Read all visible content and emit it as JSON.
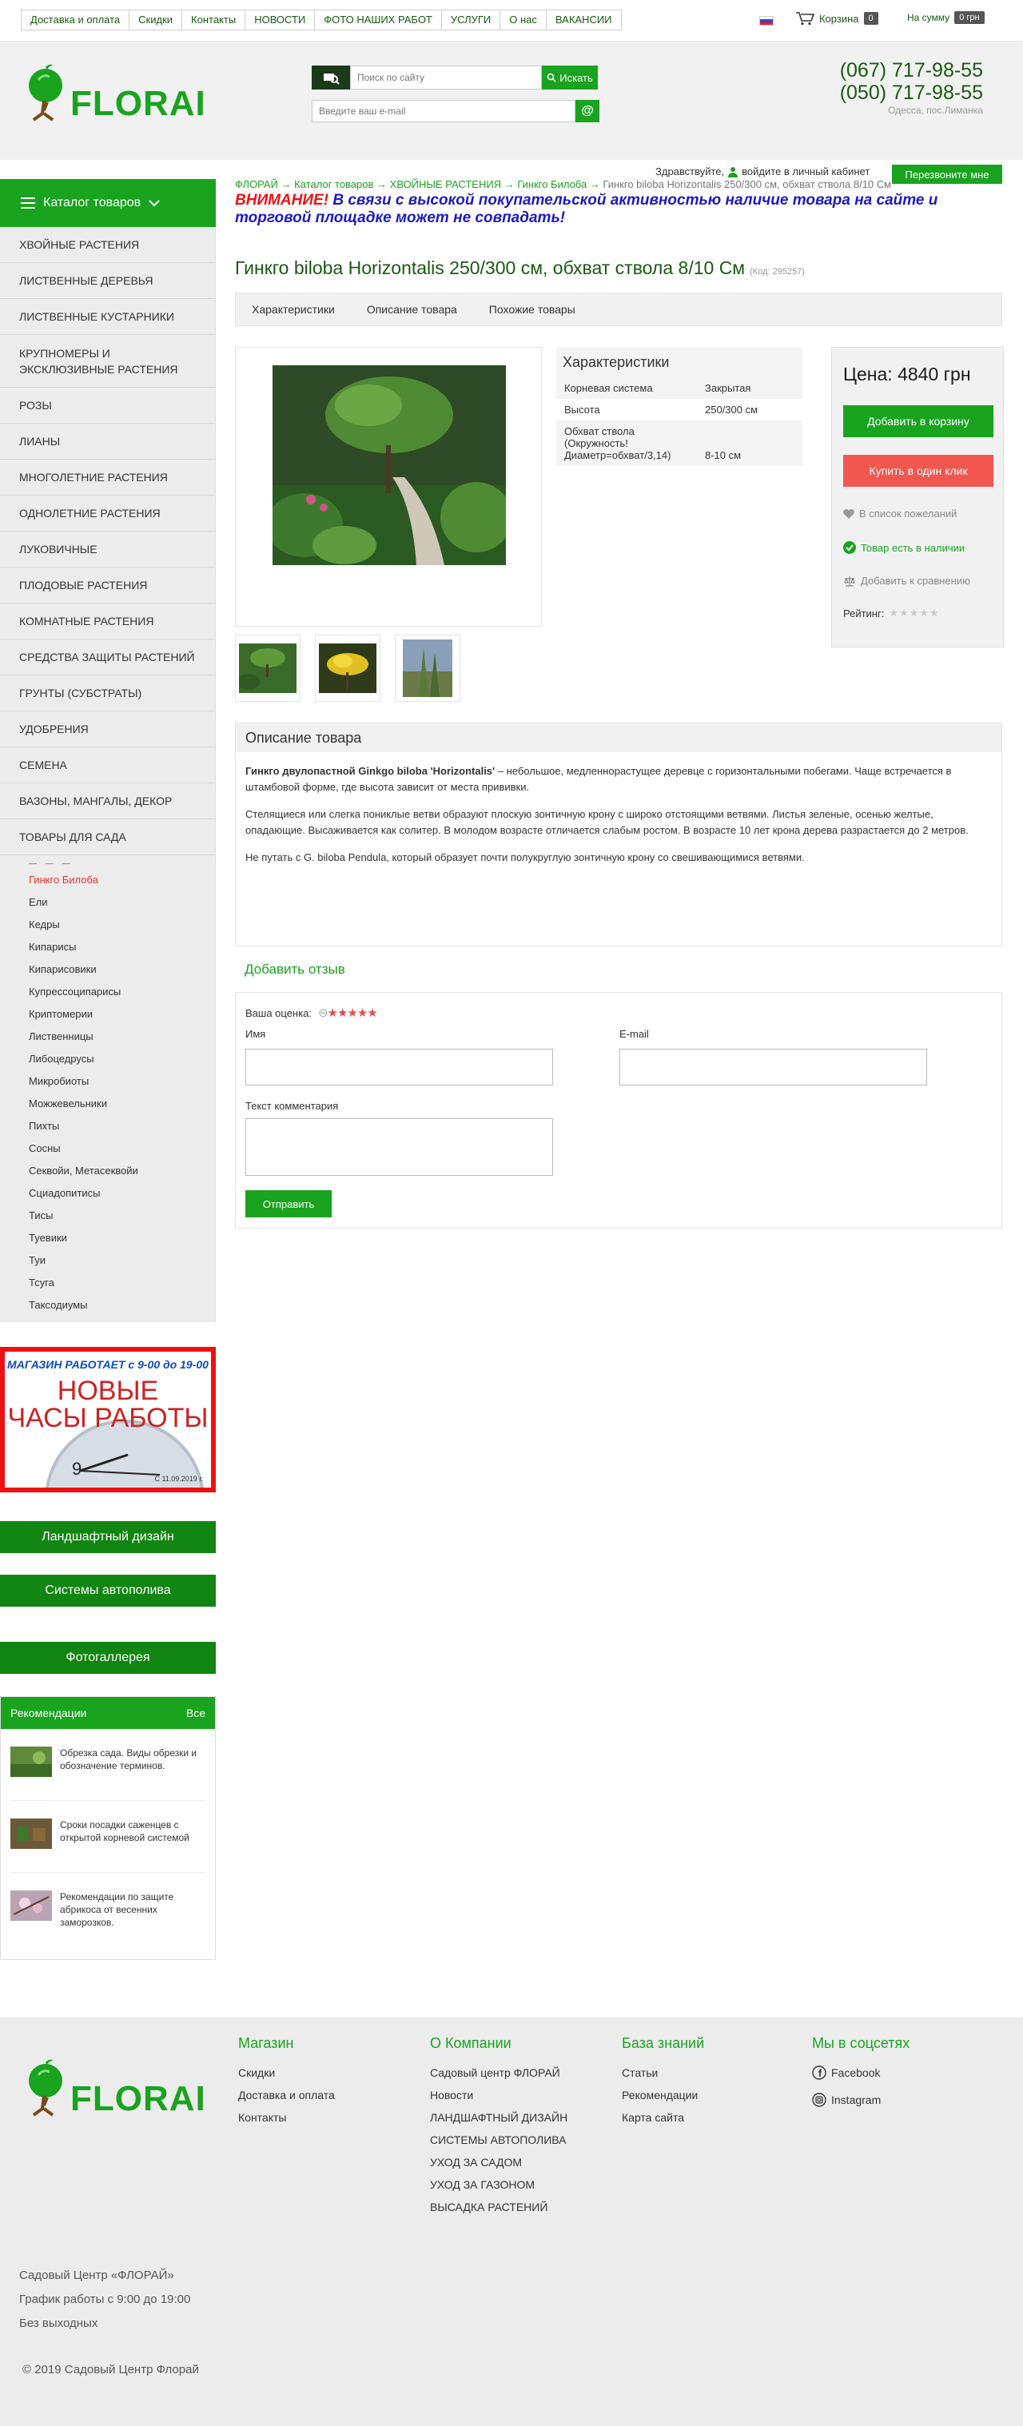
{
  "topnav": [
    "Доставка и оплата",
    "Скидки",
    "Контакты",
    "НОВОСТИ",
    "ФОТО НАШИХ РАБОТ",
    "УСЛУГИ",
    "О нас",
    "ВАКАНСИИ"
  ],
  "cart": {
    "label": "Корзина",
    "count": "0",
    "sum_label": "На сумму",
    "sum": "0 грн"
  },
  "logo": "FLORAI",
  "search": {
    "placeholder": "Поиск по сайту",
    "button": "Искать"
  },
  "email": {
    "placeholder": "Введите ваш e-mail",
    "button": "@"
  },
  "phones": [
    "(067) 717-98-55",
    "(050) 717-98-55"
  ],
  "city": "Одесса, пос.Лиманка",
  "greeting": "Здравствуйте,",
  "login_link": "войдите в личный кабинет",
  "callback": "Перезвоните мне",
  "catalog_title": "Каталог товаров",
  "categories": [
    "Хвойные растения",
    "Лиственные деревья",
    "Лиственные кустарники",
    "Крупномеры и эксклюзивные растения",
    "Розы",
    "Лианы",
    "Многолетние растения",
    "Однолетние растения",
    "Луковичные",
    "Плодовые растения",
    "Комнатные растения",
    "Средства защиты растений",
    "Грунты (субстраты)",
    "Удобрения",
    "Семена",
    "Вазоны, мангалы, декор",
    "Товары для сада"
  ],
  "subcategories": [
    "Гинкго Билоба",
    "Ели",
    "Кедры",
    "Кипарисы",
    "Кипарисовики",
    "Купрессоципарисы",
    "Криптомерии",
    "Лиственницы",
    "Либоцедрусы",
    "Микробиоты",
    "Можжевельники",
    "Пихты",
    "Сосны",
    "Секвойи, Метасеквойи",
    "Сциадопитисы",
    "Тисы",
    "Туевики",
    "Туи",
    "Тсуга",
    "Таксодиумы"
  ],
  "promo": {
    "top": "МАГАЗИН РАБОТАЕТ с 9-00 до 19-00",
    "big1": "НОВЫЕ",
    "big2": "ЧАСЫ РАБОТЫ",
    "date": "С 11.09.2019 г."
  },
  "side_buttons": [
    "Ландшафтный дизайн",
    "Системы автополива",
    "Фотогаллерея"
  ],
  "recs": {
    "title": "Рекомендации",
    "all": "Все",
    "items": [
      "Обрезка сада. Виды обрезки и обозначение терминов.",
      "Сроки посадки саженцев с открытой корневой системой",
      "Рекомендации по защите абрикоса от весенних заморозков."
    ]
  },
  "breadcrumbs": [
    "ФЛОРАЙ",
    "Каталог товаров",
    "ХВОЙНЫЕ РАСТЕНИЯ",
    "Гинкго Билоба",
    "Гинкго biloba Horizontalis 250/300 см, обхват ствола 8/10 См"
  ],
  "warning": {
    "red": "ВНИМАНИЕ!",
    "text": "В связи с высокой покупательской активностью наличие товара на сайте и торговой площадке может не совпадать!"
  },
  "product": {
    "title": "Гинкго biloba Horizontalis 250/300 см, обхват ствола 8/10 См",
    "code": "(Код: 295257)"
  },
  "tabs": [
    "Характеристики",
    "Описание товара",
    "Похожие товары"
  ],
  "characteristics": {
    "title": "Характеристики",
    "rows": [
      [
        "Корневая система",
        "Закрытая"
      ],
      [
        "Высота",
        "250/300 см"
      ],
      [
        "Обхват ствола (Окружность! Диаметр=обхват/3,14)",
        "8-10 см"
      ]
    ]
  },
  "price": "Цена: 4840 грн",
  "buy": {
    "add": "Добавить в корзину",
    "oneclick": "Купить в один клик",
    "wishlist": "В список пожеланий",
    "stock": "Товар есть в наличии",
    "compare": "Добавить к сравнению",
    "rating": "Рейтинг:"
  },
  "description": {
    "title": "Описание товара",
    "p1_bold": "Гинкго двулопастной Ginkgo biloba 'Horizontalis'",
    "p1": " – небольшое, медленнорастущее деревце с горизонтальными побегами. Чаще встречается в штамбовой форме, где высота зависит от места прививки.",
    "p2": "Стелящиеся или слегка пониклые ветви образуют плоскую зонтичную крону с широко отстоящими ветвями. Листья зеленые, осенью желтые, опадающие. Высаживается как солитер. В молодом возрасте отличается слабым ростом. В возрасте 10 лет крона дерева разрастается до 2 метров.",
    "p3": "Не путать с G. biloba Pendula, который образует почти полукруглую зонтичную крону со свешивающимися ветвями."
  },
  "review": {
    "link": "Добавить отзыв",
    "rating_label": "Ваша оценка:",
    "name": "Имя",
    "email": "E-mail",
    "comment": "Текст комментария",
    "send": "Отправить"
  },
  "footer": {
    "shop": {
      "title": "Магазин",
      "links": [
        "Скидки",
        "Доставка и оплата",
        "Контакты"
      ]
    },
    "company": {
      "title": "О Компании",
      "links": [
        "Садовый центр ФЛОРАЙ",
        "Новости",
        "ЛАНДШАФТНЫЙ ДИЗАЙН",
        "СИСТЕМЫ АВТОПОЛИВА",
        "УХОД ЗА САДОМ",
        "УХОД ЗА ГАЗОНОМ",
        "ВЫСАДКА РАСТЕНИЙ"
      ]
    },
    "kb": {
      "title": "База знаний",
      "links": [
        "Статьи",
        "Рекомендации",
        "Карта сайта"
      ]
    },
    "social": {
      "title": "Мы в соцсетях",
      "links": [
        "Facebook",
        "Instagram"
      ]
    },
    "info": [
      "Садовый Центр «ФЛОРАЙ»",
      "График работы с 9:00 до 19:00",
      "Без выходных"
    ],
    "copyright": "© 2019 Садовый Центр Флорай"
  },
  "colors": {
    "green": "#19a31f",
    "dark_green": "#118511",
    "red": "#f1564f",
    "warning_blue": "#1a1ac8"
  }
}
